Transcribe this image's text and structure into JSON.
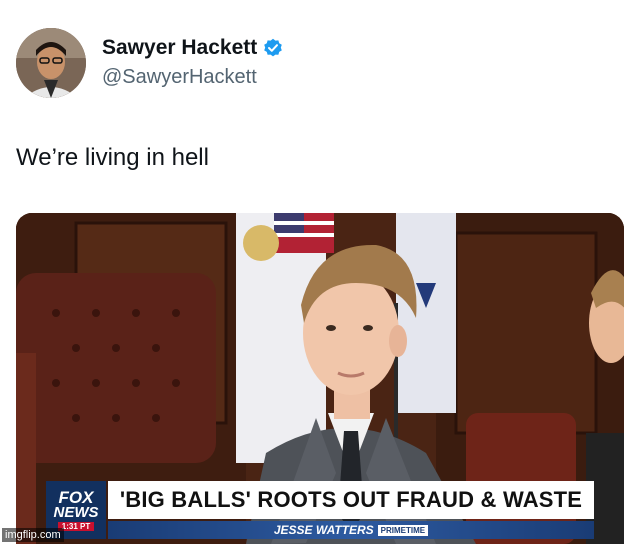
{
  "tweet": {
    "display_name": "Sawyer Hackett",
    "handle": "@SawyerHackett",
    "verified": true,
    "text": "We’re living in hell"
  },
  "media": {
    "chyron": {
      "network_logo_top": "FOX",
      "network_logo_bottom": "NEWS",
      "logo_time": "1:31 PT",
      "headline": "'BIG BALLS' ROOTS OUT FRAUD & WASTE",
      "show_name": "JESSE WATTERS",
      "show_block": "PRIMETIME"
    }
  },
  "watermark": "imgflip.com",
  "colors": {
    "verified_badge": "#1d9bf0",
    "name_text": "#0f1419",
    "handle_text": "#536471",
    "fox_blue": "#12305f",
    "fox_red": "#c8102e"
  },
  "icons": {
    "verified": "verified-badge-icon"
  }
}
